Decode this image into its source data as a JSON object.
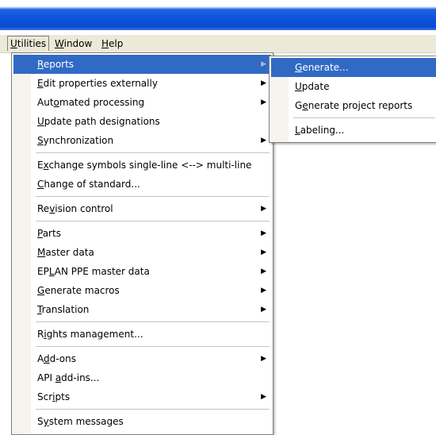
{
  "menubar": {
    "items": [
      {
        "pre": "",
        "ul": "U",
        "post": "tilities",
        "active": true
      },
      {
        "pre": "",
        "ul": "W",
        "post": "indow",
        "active": false
      },
      {
        "pre": "",
        "ul": "H",
        "post": "elp",
        "active": false
      }
    ]
  },
  "main_menu": {
    "items": [
      {
        "pre": "",
        "ul": "R",
        "post": "eports",
        "submenu": true,
        "highlight": true
      },
      {
        "pre": "",
        "ul": "E",
        "post": "dit properties externally",
        "submenu": true
      },
      {
        "pre": "Aut",
        "ul": "o",
        "post": "mated processing",
        "submenu": true
      },
      {
        "pre": "",
        "ul": "U",
        "post": "pdate path designations",
        "submenu": false
      },
      {
        "pre": "",
        "ul": "S",
        "post": "ynchronization",
        "submenu": true,
        "sep_after": true
      },
      {
        "pre": "E",
        "ul": "x",
        "post": "change symbols single-line <--> multi-line",
        "submenu": false
      },
      {
        "pre": "",
        "ul": "C",
        "post": "hange of standard...",
        "submenu": false,
        "sep_after": true
      },
      {
        "pre": "Re",
        "ul": "v",
        "post": "ision control",
        "submenu": true,
        "sep_after": true
      },
      {
        "pre": "",
        "ul": "P",
        "post": "arts",
        "submenu": true
      },
      {
        "pre": "",
        "ul": "M",
        "post": "aster data",
        "submenu": true
      },
      {
        "pre": "EP",
        "ul": "L",
        "post": "AN PPE master data",
        "submenu": true
      },
      {
        "pre": "",
        "ul": "G",
        "post": "enerate macros",
        "submenu": true
      },
      {
        "pre": "",
        "ul": "T",
        "post": "ranslation",
        "submenu": true,
        "sep_after": true
      },
      {
        "pre": "R",
        "ul": "i",
        "post": "ghts management...",
        "submenu": false,
        "sep_after": true
      },
      {
        "pre": "A",
        "ul": "d",
        "post": "d-ons",
        "submenu": true
      },
      {
        "pre": "API ",
        "ul": "a",
        "post": "dd-ins...",
        "submenu": false
      },
      {
        "pre": "Scr",
        "ul": "i",
        "post": "pts",
        "submenu": true,
        "sep_after": true
      },
      {
        "pre": "S",
        "ul": "y",
        "post": "stem messages",
        "submenu": false
      }
    ]
  },
  "sub_menu": {
    "items": [
      {
        "pre": "",
        "ul": "G",
        "post": "enerate...",
        "highlight": true
      },
      {
        "pre": "",
        "ul": "U",
        "post": "pdate"
      },
      {
        "pre": "G",
        "ul": "e",
        "post": "nerate project reports",
        "sep_after": true
      },
      {
        "pre": "",
        "ul": "L",
        "post": "abeling..."
      }
    ]
  },
  "icons": {
    "submenu_arrow": "chevron-right-icon"
  },
  "colors": {
    "highlight": "#316ac5",
    "titlebar": "#0a4bd0",
    "menubar": "#ece9d8"
  }
}
